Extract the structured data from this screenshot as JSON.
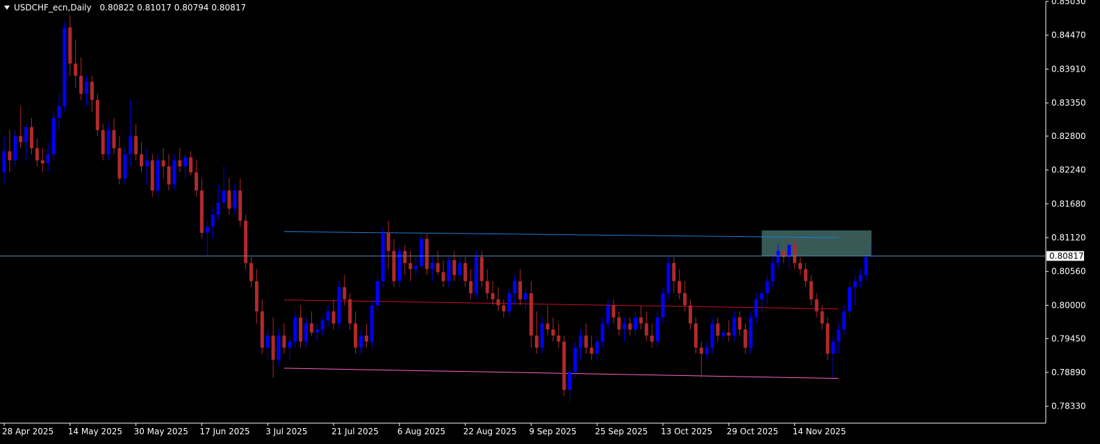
{
  "header": {
    "symbol": "USDCHF_ecn,Daily",
    "open": "0.80822",
    "high": "0.81017",
    "low": "0.80794",
    "close": "0.80817"
  },
  "price_label": "0.80817",
  "colors": {
    "background": "#000000",
    "axis": "#ffffff",
    "bull": "#0000ff",
    "bear": "#b02a2a",
    "upper_channel": "#1e7fd8",
    "middle_channel": "#c8102e",
    "lower_channel": "#ff66cc",
    "zone": "#3a5f5c",
    "current_price_line": "#5a8ab8"
  },
  "chart_data": {
    "type": "candlestick",
    "title": "",
    "ylim": [
      0.7805,
      0.8503
    ],
    "y_ticks": [
      "0.85030",
      "0.84470",
      "0.83910",
      "0.83350",
      "0.82800",
      "0.82240",
      "0.81680",
      "0.81120",
      "0.80560",
      "0.80000",
      "0.79450",
      "0.78890",
      "0.78330"
    ],
    "x_ticks": [
      {
        "index": 0,
        "label": "28 Apr 2025"
      },
      {
        "index": 12,
        "label": "14 May 2025"
      },
      {
        "index": 24,
        "label": "30 May 2025"
      },
      {
        "index": 36,
        "label": "17 Jun 2025"
      },
      {
        "index": 48,
        "label": "3 Jul 2025"
      },
      {
        "index": 60,
        "label": "21 Jul 2025"
      },
      {
        "index": 72,
        "label": "6 Aug 2025"
      },
      {
        "index": 84,
        "label": "22 Aug 2025"
      },
      {
        "index": 96,
        "label": "9 Sep 2025"
      },
      {
        "index": 108,
        "label": "25 Sep 2025"
      },
      {
        "index": 120,
        "label": "13 Oct 2025"
      },
      {
        "index": 132,
        "label": "29 Oct 2025"
      },
      {
        "index": 144,
        "label": "14 Nov 2025"
      }
    ],
    "candles": [
      [
        0.822,
        0.828,
        0.82,
        0.8255
      ],
      [
        0.8255,
        0.829,
        0.822,
        0.824
      ],
      [
        0.824,
        0.829,
        0.823,
        0.828
      ],
      [
        0.828,
        0.833,
        0.826,
        0.827
      ],
      [
        0.827,
        0.83,
        0.824,
        0.8295
      ],
      [
        0.8295,
        0.831,
        0.825,
        0.826
      ],
      [
        0.826,
        0.8275,
        0.823,
        0.824
      ],
      [
        0.824,
        0.826,
        0.822,
        0.8235
      ],
      [
        0.8235,
        0.827,
        0.822,
        0.825
      ],
      [
        0.825,
        0.832,
        0.824,
        0.831
      ],
      [
        0.831,
        0.835,
        0.829,
        0.833
      ],
      [
        0.833,
        0.847,
        0.832,
        0.846
      ],
      [
        0.846,
        0.848,
        0.838,
        0.84
      ],
      [
        0.84,
        0.844,
        0.836,
        0.838
      ],
      [
        0.838,
        0.841,
        0.834,
        0.835
      ],
      [
        0.835,
        0.838,
        0.833,
        0.837
      ],
      [
        0.837,
        0.838,
        0.832,
        0.834
      ],
      [
        0.834,
        0.835,
        0.828,
        0.829
      ],
      [
        0.829,
        0.83,
        0.824,
        0.825
      ],
      [
        0.825,
        0.83,
        0.824,
        0.829
      ],
      [
        0.829,
        0.831,
        0.825,
        0.826
      ],
      [
        0.826,
        0.828,
        0.82,
        0.821
      ],
      [
        0.821,
        0.826,
        0.82,
        0.825
      ],
      [
        0.825,
        0.834,
        0.823,
        0.828
      ],
      [
        0.828,
        0.83,
        0.824,
        0.825
      ],
      [
        0.825,
        0.827,
        0.822,
        0.823
      ],
      [
        0.823,
        0.826,
        0.82,
        0.824
      ],
      [
        0.824,
        0.825,
        0.818,
        0.819
      ],
      [
        0.819,
        0.825,
        0.818,
        0.824
      ],
      [
        0.824,
        0.826,
        0.821,
        0.823
      ],
      [
        0.823,
        0.825,
        0.819,
        0.82
      ],
      [
        0.82,
        0.825,
        0.819,
        0.824
      ],
      [
        0.824,
        0.826,
        0.822,
        0.823
      ],
      [
        0.823,
        0.825,
        0.821,
        0.8245
      ],
      [
        0.8245,
        0.8255,
        0.8215,
        0.822
      ],
      [
        0.822,
        0.824,
        0.818,
        0.819
      ],
      [
        0.819,
        0.821,
        0.811,
        0.812
      ],
      [
        0.812,
        0.814,
        0.808,
        0.813
      ],
      [
        0.813,
        0.816,
        0.811,
        0.815
      ],
      [
        0.815,
        0.82,
        0.814,
        0.817
      ],
      [
        0.817,
        0.823,
        0.816,
        0.819
      ],
      [
        0.819,
        0.821,
        0.815,
        0.816
      ],
      [
        0.816,
        0.82,
        0.815,
        0.819
      ],
      [
        0.819,
        0.821,
        0.813,
        0.814
      ],
      [
        0.814,
        0.815,
        0.806,
        0.807
      ],
      [
        0.807,
        0.808,
        0.803,
        0.804
      ],
      [
        0.804,
        0.806,
        0.797,
        0.799
      ],
      [
        0.799,
        0.801,
        0.792,
        0.793
      ],
      [
        0.793,
        0.796,
        0.791,
        0.795
      ],
      [
        0.795,
        0.798,
        0.788,
        0.791
      ],
      [
        0.791,
        0.796,
        0.79,
        0.795
      ],
      [
        0.795,
        0.797,
        0.792,
        0.793
      ],
      [
        0.793,
        0.795,
        0.791,
        0.794
      ],
      [
        0.794,
        0.799,
        0.793,
        0.798
      ],
      [
        0.798,
        0.8,
        0.793,
        0.794
      ],
      [
        0.794,
        0.798,
        0.793,
        0.797
      ],
      [
        0.797,
        0.799,
        0.795,
        0.7955
      ],
      [
        0.7955,
        0.797,
        0.794,
        0.796
      ],
      [
        0.796,
        0.798,
        0.795,
        0.7975
      ],
      [
        0.7975,
        0.8,
        0.7965,
        0.799
      ],
      [
        0.799,
        0.801,
        0.796,
        0.797
      ],
      [
        0.797,
        0.804,
        0.796,
        0.803
      ],
      [
        0.803,
        0.805,
        0.8,
        0.801
      ],
      [
        0.801,
        0.802,
        0.796,
        0.797
      ],
      [
        0.797,
        0.799,
        0.792,
        0.793
      ],
      [
        0.793,
        0.796,
        0.792,
        0.795
      ],
      [
        0.795,
        0.797,
        0.793,
        0.794
      ],
      [
        0.794,
        0.801,
        0.793,
        0.8
      ],
      [
        0.8,
        0.805,
        0.799,
        0.804
      ],
      [
        0.804,
        0.813,
        0.803,
        0.812
      ],
      [
        0.812,
        0.814,
        0.806,
        0.809
      ],
      [
        0.809,
        0.811,
        0.803,
        0.804
      ],
      [
        0.804,
        0.81,
        0.803,
        0.809
      ],
      [
        0.809,
        0.81,
        0.805,
        0.807
      ],
      [
        0.807,
        0.809,
        0.804,
        0.806
      ],
      [
        0.806,
        0.808,
        0.805,
        0.8065
      ],
      [
        0.8065,
        0.812,
        0.806,
        0.811
      ],
      [
        0.811,
        0.812,
        0.805,
        0.806
      ],
      [
        0.806,
        0.808,
        0.804,
        0.807
      ],
      [
        0.807,
        0.809,
        0.805,
        0.8055
      ],
      [
        0.8055,
        0.8075,
        0.803,
        0.804
      ],
      [
        0.804,
        0.808,
        0.803,
        0.8075
      ],
      [
        0.8075,
        0.809,
        0.804,
        0.805
      ],
      [
        0.805,
        0.808,
        0.804,
        0.807
      ],
      [
        0.807,
        0.808,
        0.803,
        0.804
      ],
      [
        0.804,
        0.806,
        0.801,
        0.802
      ],
      [
        0.802,
        0.809,
        0.801,
        0.808
      ],
      [
        0.808,
        0.809,
        0.803,
        0.804
      ],
      [
        0.804,
        0.806,
        0.801,
        0.802
      ],
      [
        0.802,
        0.804,
        0.8,
        0.801
      ],
      [
        0.801,
        0.803,
        0.799,
        0.8
      ],
      [
        0.8,
        0.801,
        0.798,
        0.799
      ],
      [
        0.799,
        0.803,
        0.798,
        0.802
      ],
      [
        0.802,
        0.805,
        0.8,
        0.804
      ],
      [
        0.804,
        0.806,
        0.8,
        0.801
      ],
      [
        0.801,
        0.803,
        0.799,
        0.802
      ],
      [
        0.802,
        0.804,
        0.793,
        0.795
      ],
      [
        0.795,
        0.799,
        0.792,
        0.793
      ],
      [
        0.793,
        0.798,
        0.792,
        0.797
      ],
      [
        0.797,
        0.8,
        0.795,
        0.796
      ],
      [
        0.796,
        0.798,
        0.794,
        0.795
      ],
      [
        0.795,
        0.797,
        0.793,
        0.794
      ],
      [
        0.794,
        0.795,
        0.785,
        0.786
      ],
      [
        0.786,
        0.79,
        0.784,
        0.789
      ],
      [
        0.789,
        0.794,
        0.788,
        0.793
      ],
      [
        0.793,
        0.796,
        0.791,
        0.795
      ],
      [
        0.795,
        0.797,
        0.792,
        0.793
      ],
      [
        0.793,
        0.795,
        0.791,
        0.792
      ],
      [
        0.792,
        0.795,
        0.791,
        0.794
      ],
      [
        0.794,
        0.798,
        0.793,
        0.797
      ],
      [
        0.797,
        0.801,
        0.796,
        0.8
      ],
      [
        0.8,
        0.801,
        0.797,
        0.798
      ],
      [
        0.798,
        0.799,
        0.795,
        0.796
      ],
      [
        0.796,
        0.798,
        0.794,
        0.797
      ],
      [
        0.797,
        0.798,
        0.795,
        0.796
      ],
      [
        0.796,
        0.799,
        0.795,
        0.798
      ],
      [
        0.798,
        0.8,
        0.796,
        0.797
      ],
      [
        0.797,
        0.799,
        0.794,
        0.795
      ],
      [
        0.795,
        0.797,
        0.793,
        0.794
      ],
      [
        0.794,
        0.799,
        0.793,
        0.798
      ],
      [
        0.798,
        0.803,
        0.797,
        0.802
      ],
      [
        0.802,
        0.808,
        0.801,
        0.807
      ],
      [
        0.807,
        0.808,
        0.802,
        0.804
      ],
      [
        0.804,
        0.806,
        0.801,
        0.802
      ],
      [
        0.802,
        0.804,
        0.799,
        0.8
      ],
      [
        0.8,
        0.801,
        0.796,
        0.797
      ],
      [
        0.797,
        0.798,
        0.792,
        0.793
      ],
      [
        0.793,
        0.794,
        0.788,
        0.792
      ],
      [
        0.792,
        0.794,
        0.791,
        0.793
      ],
      [
        0.793,
        0.798,
        0.792,
        0.797
      ],
      [
        0.797,
        0.798,
        0.794,
        0.795
      ],
      [
        0.795,
        0.796,
        0.794,
        0.7955
      ],
      [
        0.7955,
        0.7975,
        0.794,
        0.795
      ],
      [
        0.795,
        0.799,
        0.794,
        0.798
      ],
      [
        0.798,
        0.799,
        0.795,
        0.796
      ],
      [
        0.796,
        0.797,
        0.792,
        0.793
      ],
      [
        0.793,
        0.799,
        0.792,
        0.798
      ],
      [
        0.798,
        0.802,
        0.797,
        0.801
      ],
      [
        0.801,
        0.803,
        0.799,
        0.802
      ],
      [
        0.802,
        0.805,
        0.8,
        0.804
      ],
      [
        0.804,
        0.808,
        0.803,
        0.807
      ],
      [
        0.807,
        0.81,
        0.806,
        0.809
      ],
      [
        0.809,
        0.811,
        0.807,
        0.808
      ],
      [
        0.808,
        0.81,
        0.806,
        0.81
      ],
      [
        0.81,
        0.811,
        0.806,
        0.807
      ],
      [
        0.807,
        0.808,
        0.805,
        0.806
      ],
      [
        0.806,
        0.807,
        0.803,
        0.804
      ],
      [
        0.804,
        0.805,
        0.8,
        0.801
      ],
      [
        0.801,
        0.802,
        0.798,
        0.799
      ],
      [
        0.799,
        0.8,
        0.796,
        0.797
      ],
      [
        0.797,
        0.798,
        0.791,
        0.792
      ],
      [
        0.792,
        0.795,
        0.788,
        0.794
      ],
      [
        0.794,
        0.797,
        0.792,
        0.796
      ],
      [
        0.796,
        0.8,
        0.795,
        0.799
      ],
      [
        0.799,
        0.804,
        0.798,
        0.803
      ],
      [
        0.803,
        0.805,
        0.8,
        0.804
      ],
      [
        0.804,
        0.806,
        0.803,
        0.805
      ],
      [
        0.805,
        0.808,
        0.804,
        0.808
      ],
      [
        0.8082,
        0.8102,
        0.8079,
        0.8082
      ]
    ],
    "channels": [
      {
        "name": "upper",
        "start_index": 51,
        "end_index": 152,
        "start_value": 0.8122,
        "end_value": 0.8112
      },
      {
        "name": "middle",
        "start_index": 51,
        "end_index": 152,
        "start_value": 0.8009,
        "end_value": 0.7994
      },
      {
        "name": "lower",
        "start_index": 51,
        "end_index": 152,
        "start_value": 0.7896,
        "end_value": 0.7879
      }
    ],
    "zone": {
      "start_index": 138,
      "end_index": 158,
      "top_value": 0.8124,
      "bottom_value": 0.80817
    },
    "current_price": 0.80817
  }
}
